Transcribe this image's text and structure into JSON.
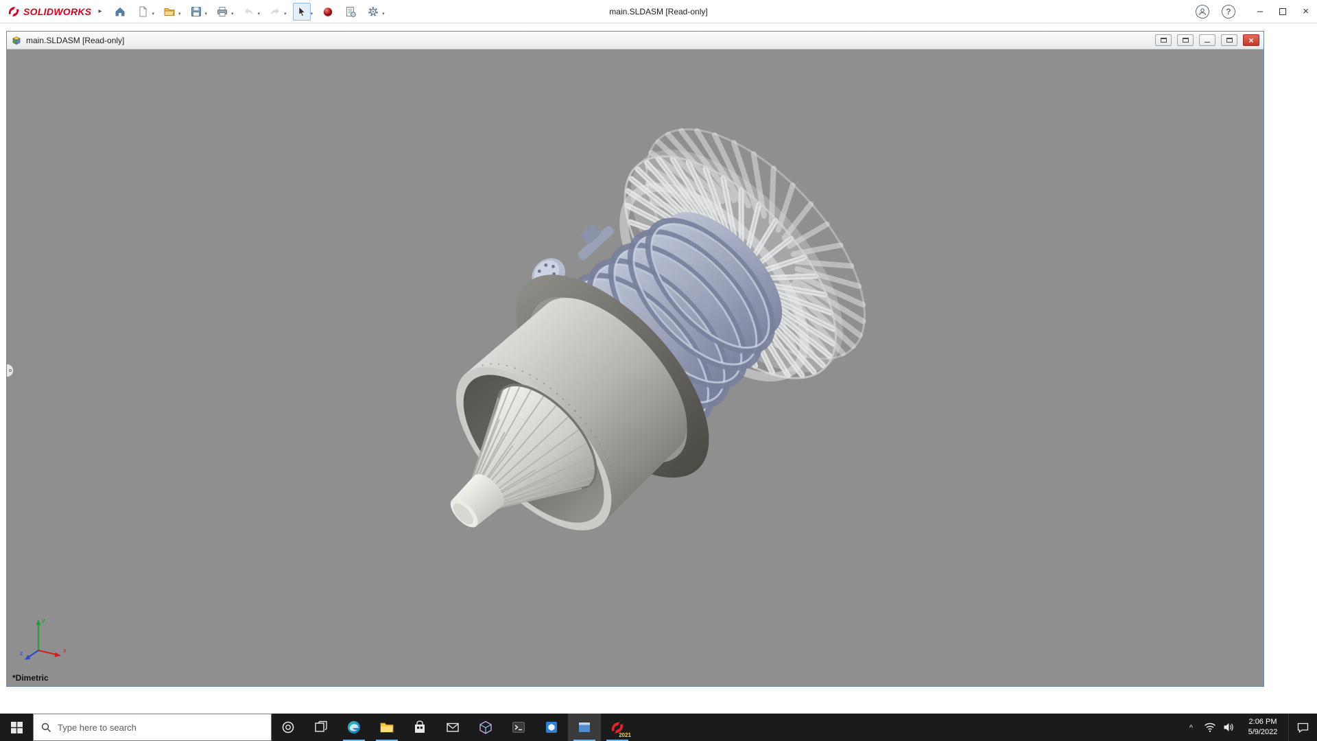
{
  "app": {
    "brand": "SOLIDWORKS",
    "window_title": "main.SLDASM [Read-only]",
    "toolbar_tools": [
      "home",
      "new-document",
      "open",
      "save",
      "print",
      "undo",
      "redo",
      "select",
      "appearances",
      "document-options",
      "settings"
    ]
  },
  "doc_window": {
    "title": "main.SLDASM [Read-only]",
    "view_label": "*Dimetric",
    "triad": {
      "x": "x",
      "y": "y",
      "z": "z"
    }
  },
  "taskbar": {
    "search_placeholder": "Type here to search",
    "solidworks_badge": "2021",
    "clock_time": "2:06 PM",
    "clock_date": "5/9/2022"
  },
  "icons": {
    "dropdown": "▾",
    "expand_arrow": "▸",
    "minimize": "–",
    "close": "×",
    "help": "?",
    "tray_chevron": "^"
  },
  "colors": {
    "brand_red": "#d6001c",
    "viewport_gray": "#8f8f8f",
    "taskbar_bg": "#1b1b1b",
    "doc_close_red": "#c0392b"
  }
}
